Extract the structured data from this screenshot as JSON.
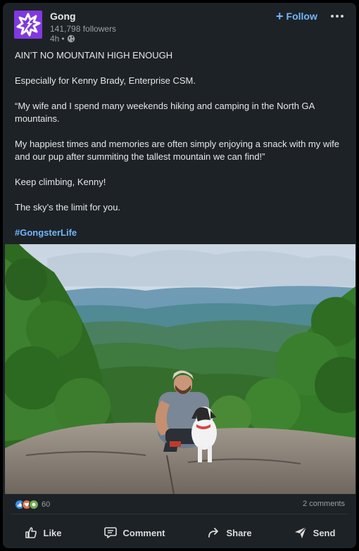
{
  "post": {
    "company": "Gong",
    "followers": "141,798 followers",
    "time": "4h",
    "separator": "•",
    "follow_label": "Follow",
    "follow_plus": "+",
    "body": [
      "AIN’T NO MOUNTAIN HIGH ENOUGH",
      "Especially for Kenny Brady, Enterprise CSM.",
      "“My wife and I spend many weekends hiking and camping in the North GA mountains.",
      "My happiest times and memories are often simply enjoying a snack with my wife and our pup after summiting the tallest mountain we can find!”",
      "Keep climbing, Kenny!",
      "The sky’s the limit for you."
    ],
    "hashtag": "#GongsterLife"
  },
  "social": {
    "reaction_count": "60",
    "comments": "2 comments"
  },
  "actions": {
    "like": "Like",
    "comment": "Comment",
    "share": "Share",
    "send": "Send"
  },
  "colors": {
    "card_bg": "#1d2226",
    "brand": "#8039df",
    "link": "#71b7fb"
  },
  "icons": [
    "globe-icon",
    "more-icon",
    "like-icon",
    "comment-icon",
    "share-icon",
    "send-icon"
  ]
}
